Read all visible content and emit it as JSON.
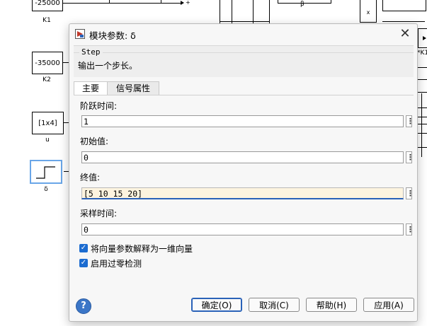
{
  "background_model": {
    "blocks": [
      {
        "id": "k1",
        "value": "-25000",
        "name": "K1"
      },
      {
        "id": "k2",
        "value": "-35000",
        "name": "K2"
      },
      {
        "id": "u",
        "value": "[1x4]",
        "name": "u"
      },
      {
        "id": "delta",
        "value": "",
        "name": "δ"
      }
    ],
    "beta_label": "β",
    "x_label": "x",
    "k1_right_label": "*K1",
    "plus_sign": "+"
  },
  "dialog": {
    "title": "模块参数: δ",
    "description_group": "Step",
    "description": "输出一个步长。",
    "tabs": [
      "主要",
      "信号属性"
    ],
    "params": [
      {
        "label": "阶跃时间:",
        "value": "1"
      },
      {
        "label": "初始值:",
        "value": "0"
      },
      {
        "label": "终值:",
        "value": "[5 10 15 20]"
      },
      {
        "label": "采样时间:",
        "value": "0"
      }
    ],
    "checkboxes": [
      {
        "label": "将向量参数解释为一维向量",
        "checked": true
      },
      {
        "label": "启用过零检测",
        "checked": true
      }
    ],
    "buttons": {
      "ok": "确定(O)",
      "cancel": "取消(C)",
      "help": "帮助(H)",
      "apply": "应用(A)"
    },
    "icons": {
      "close": "close-icon",
      "help": "help-icon",
      "more": "kebab-icon"
    }
  },
  "colors": {
    "accent": "#2a62b8",
    "checkbox": "#1c6cd0",
    "edit_bg": "#fdf4df"
  }
}
